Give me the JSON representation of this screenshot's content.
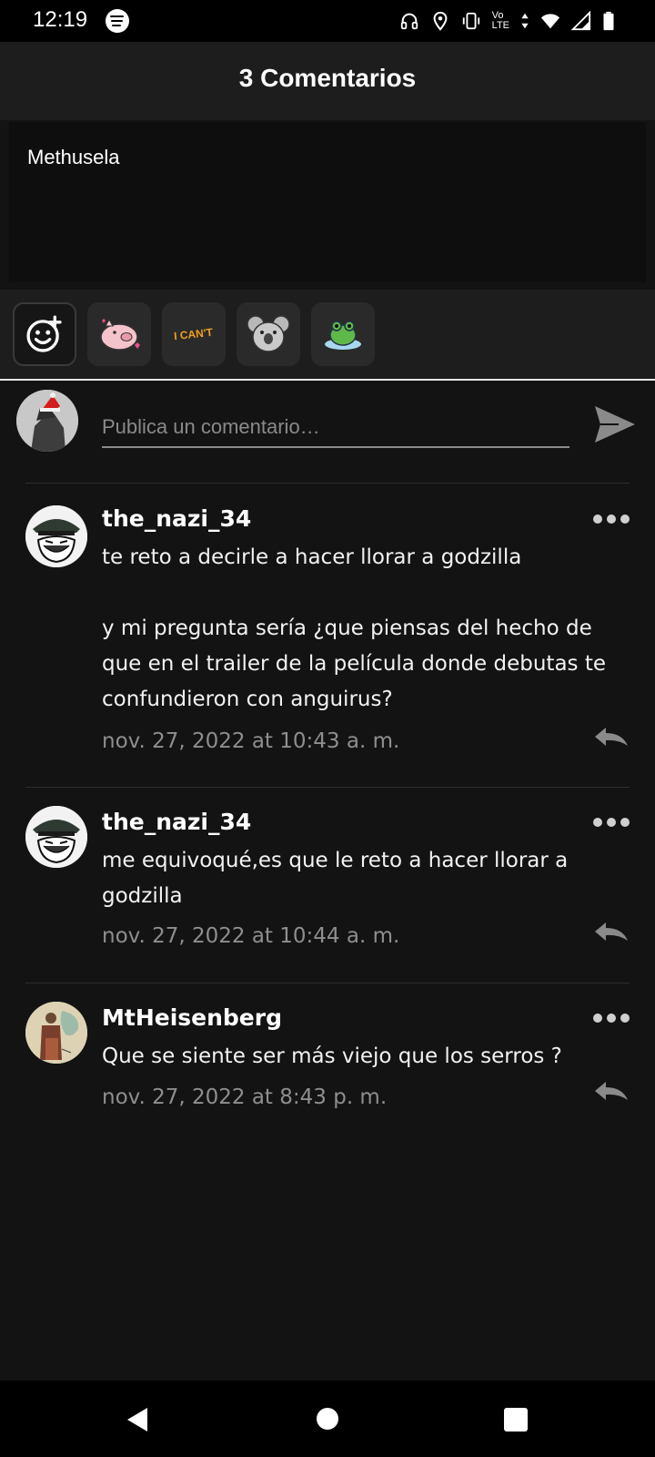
{
  "status_bar": {
    "time": "12:19",
    "volte_top": "Vo",
    "volte_bottom": "LTE",
    "icons": [
      "spotify-icon",
      "headphones-icon",
      "location-icon",
      "vibrate-icon",
      "volte-icon",
      "data-arrows-icon",
      "wifi-icon",
      "signal-icon",
      "battery-icon"
    ]
  },
  "header": {
    "title": "3 Comentarios"
  },
  "topic": {
    "text": "Methusela"
  },
  "stickers": {
    "items": [
      "add-emoji-icon",
      "pig-sticker",
      "i-cant-sticker",
      "koala-sticker",
      "frog-sticker"
    ],
    "cant_text": "I CAN'T"
  },
  "compose": {
    "placeholder": "Publica un comentario…"
  },
  "comments": [
    {
      "username": "the_nazi_34",
      "body": "te reto a decirle a hacer llorar a godzilla\n\ny mi pregunta sería ¿que piensas del hecho de que en el trailer de la película donde debutas te confundieron con anguirus?",
      "date": "nov. 27, 2022 at 10:43 a. m."
    },
    {
      "username": "the_nazi_34",
      "body": "me equivoqué,es que le reto a hacer llorar a godzilla",
      "date": "nov. 27, 2022 at 10:44 a. m."
    },
    {
      "username": "MtHeisenberg",
      "body": "Que se siente ser más viejo que los serros ?",
      "date": "nov. 27, 2022 at 8:43 p. m."
    }
  ],
  "colors": {
    "background": "#131313",
    "header": "#1d1d1d",
    "muted_text": "#8e8e8e"
  }
}
